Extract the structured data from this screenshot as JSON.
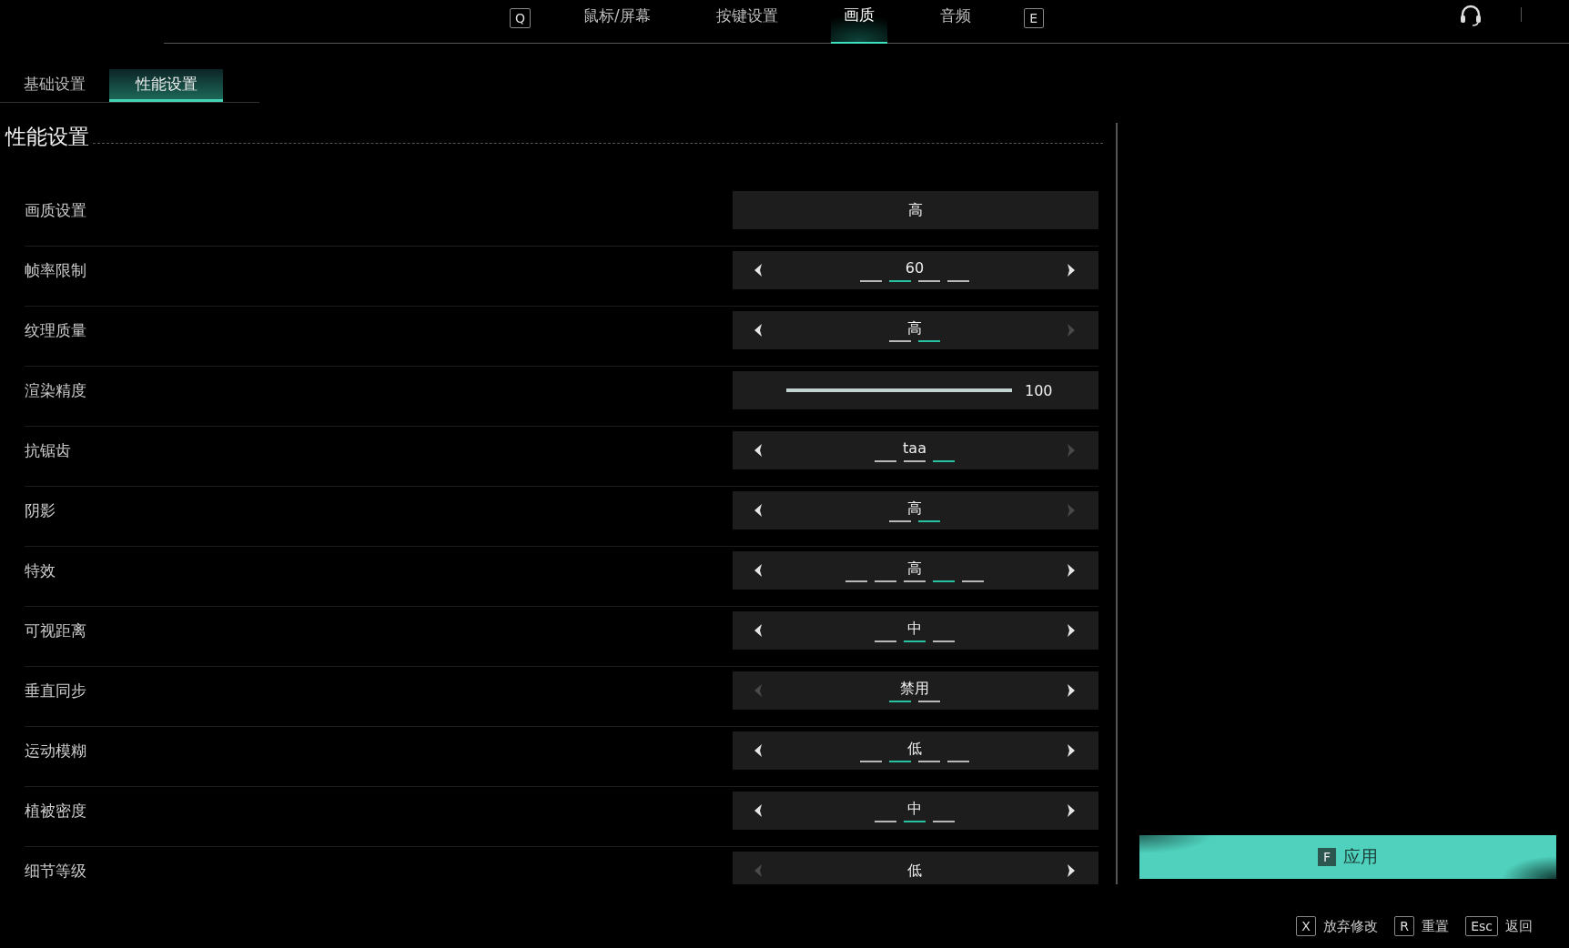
{
  "top_nav": {
    "prev_key": "Q",
    "next_key": "E",
    "tabs": [
      {
        "label": "鼠标/屏幕",
        "selected": false
      },
      {
        "label": "按键设置",
        "selected": false
      },
      {
        "label": "画质",
        "selected": true
      },
      {
        "label": "音频",
        "selected": false
      }
    ]
  },
  "sub_tabs": [
    {
      "label": "基础设置",
      "selected": false
    },
    {
      "label": "性能设置",
      "selected": true
    }
  ],
  "section_title": "性能设置",
  "settings": [
    {
      "label": "画质设置",
      "kind": "select",
      "value": "高"
    },
    {
      "label": "帧率限制",
      "kind": "stepper",
      "value": "60",
      "prev_enabled": true,
      "next_enabled": true,
      "options": [
        {
          "selected": false
        },
        {
          "selected": true
        },
        {
          "selected": false
        },
        {
          "selected": false
        }
      ]
    },
    {
      "label": "纹理质量",
      "kind": "stepper",
      "value": "高",
      "prev_enabled": true,
      "next_enabled": false,
      "options": [
        {
          "selected": false
        },
        {
          "selected": true
        }
      ]
    },
    {
      "label": "渲染精度",
      "kind": "slider",
      "level": 1,
      "reading": "100"
    },
    {
      "label": "抗锯齿",
      "kind": "stepper",
      "value": "taa",
      "prev_enabled": true,
      "next_enabled": false,
      "options": [
        {
          "selected": false
        },
        {
          "selected": false
        },
        {
          "selected": true
        }
      ]
    },
    {
      "label": "阴影",
      "kind": "stepper",
      "value": "高",
      "prev_enabled": true,
      "next_enabled": false,
      "options": [
        {
          "selected": false
        },
        {
          "selected": true
        }
      ]
    },
    {
      "label": "特效",
      "kind": "stepper",
      "value": "高",
      "prev_enabled": true,
      "next_enabled": true,
      "options": [
        {
          "selected": false
        },
        {
          "selected": false
        },
        {
          "selected": false
        },
        {
          "selected": true
        },
        {
          "selected": false
        }
      ]
    },
    {
      "label": "可视距离",
      "kind": "stepper",
      "value": "中",
      "prev_enabled": true,
      "next_enabled": true,
      "options": [
        {
          "selected": false
        },
        {
          "selected": true
        },
        {
          "selected": false
        }
      ]
    },
    {
      "label": "垂直同步",
      "kind": "stepper",
      "value": "禁用",
      "prev_enabled": false,
      "next_enabled": true,
      "options": [
        {
          "selected": true
        },
        {
          "selected": false
        }
      ]
    },
    {
      "label": "运动模糊",
      "kind": "stepper",
      "value": "低",
      "prev_enabled": true,
      "next_enabled": true,
      "options": [
        {
          "selected": false
        },
        {
          "selected": true
        },
        {
          "selected": false
        },
        {
          "selected": false
        }
      ]
    },
    {
      "label": "植被密度",
      "kind": "stepper",
      "value": "中",
      "prev_enabled": true,
      "next_enabled": true,
      "options": [
        {
          "selected": false
        },
        {
          "selected": true
        },
        {
          "selected": false
        }
      ]
    },
    {
      "label": "细节等级",
      "kind": "stepper",
      "value": "低",
      "prev_enabled": false,
      "next_enabled": true
    }
  ],
  "apply_button": {
    "key": "F",
    "label": "应用"
  },
  "hints": [
    {
      "key": "X",
      "label": "放弃修改"
    },
    {
      "key": "R",
      "label": "重置"
    },
    {
      "key": "Esc",
      "label": "返回"
    }
  ]
}
